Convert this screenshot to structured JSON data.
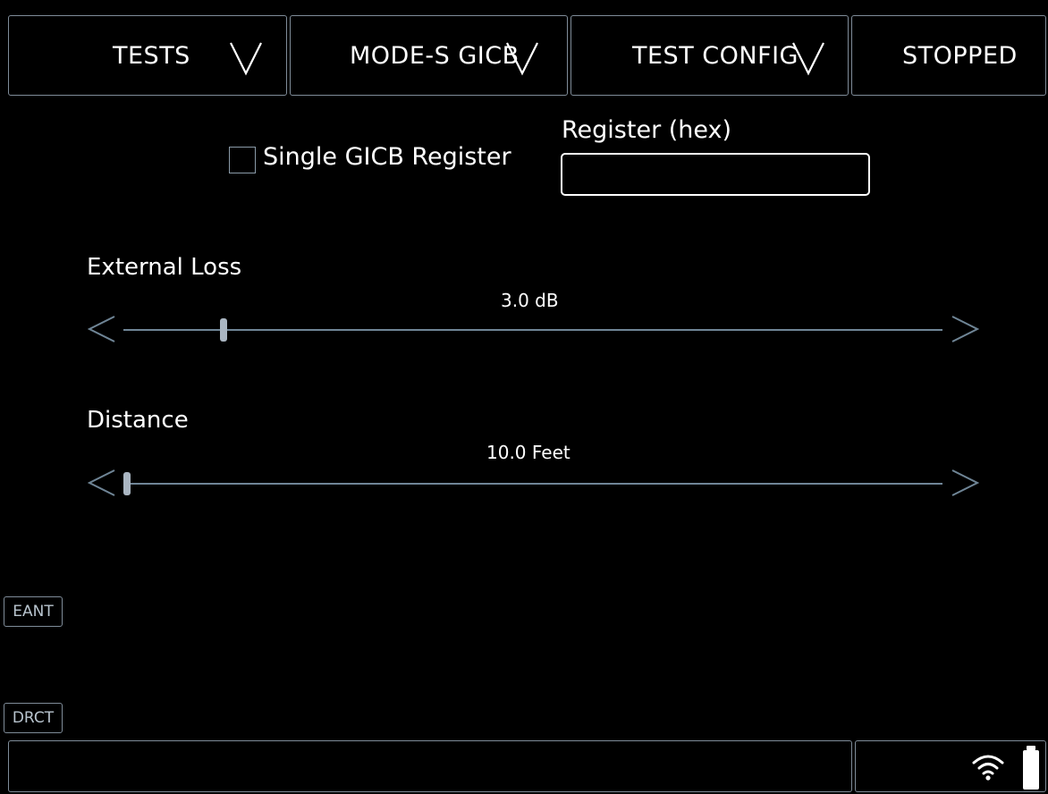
{
  "header": {
    "tests_label": "TESTS",
    "mode_label": "MODE-S GICB",
    "config_label": "TEST CONFIG",
    "status_label": "STOPPED"
  },
  "register": {
    "checkbox_label": "Single GICB Register",
    "checked": false,
    "input_label": "Register (hex)",
    "input_value": ""
  },
  "external_loss": {
    "label": "External Loss",
    "value_text": "3.0 dB"
  },
  "distance": {
    "label": "Distance",
    "value_text": "10.0 Feet"
  },
  "side_buttons": {
    "eant": "EANT",
    "drct": "DRCT"
  },
  "status_icons": [
    "wifi-icon",
    "battery-icon"
  ],
  "colors": {
    "background": "#000000",
    "border": "#7f8c99",
    "track": "#6f8596",
    "text": "#ffffff"
  }
}
